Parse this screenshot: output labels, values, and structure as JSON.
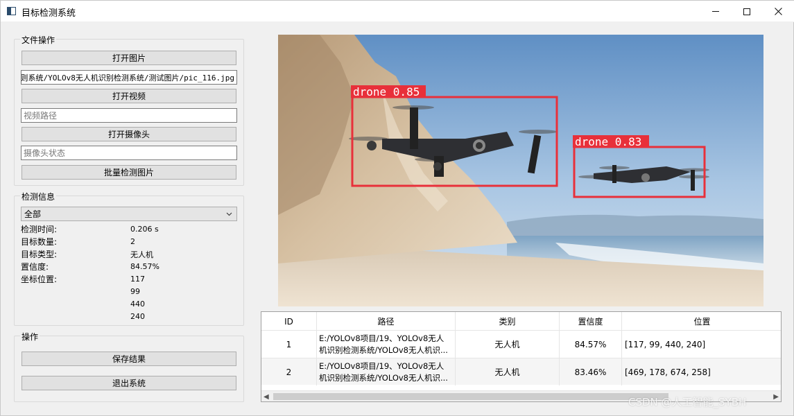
{
  "window": {
    "title": "目标检测系统"
  },
  "file_ops": {
    "group_title": "文件操作",
    "open_image_label": "打开图片",
    "image_path_value": "则系统/YOLOv8无人机识别检测系统/测试图片/pic_116.jpg",
    "open_video_label": "打开视频",
    "video_path_placeholder": "视频路径",
    "open_camera_label": "打开摄像头",
    "camera_status_placeholder": "摄像头状态",
    "batch_detect_label": "批量检测图片"
  },
  "detect_info": {
    "group_title": "检测信息",
    "filter_value": "全部",
    "time_label": "检测时间:",
    "time_value": "0.206 s",
    "count_label": "目标数量:",
    "count_value": "2",
    "type_label": "目标类型:",
    "type_value": "无人机",
    "conf_label": "置信度:",
    "conf_value": "84.57%",
    "coord_label": "坐标位置:",
    "coords": [
      "117",
      "99",
      "440",
      "240"
    ]
  },
  "ops": {
    "group_title": "操作",
    "save_label": "保存结果",
    "exit_label": "退出系统"
  },
  "detections_overlay": [
    {
      "label": "drone 0.85"
    },
    {
      "label": "drone 0.83"
    }
  ],
  "table": {
    "headers": [
      "ID",
      "路径",
      "类别",
      "置信度",
      "位置"
    ],
    "rows": [
      {
        "id": "1",
        "path_line1": "E:/YOLOv8项目/19、YOLOv8无人",
        "path_line2": "机识别检测系统/YOLOv8无人机识...",
        "class": "无人机",
        "conf": "84.57%",
        "position": "[117, 99, 440, 240]"
      },
      {
        "id": "2",
        "path_line1": "E:/YOLOv8项目/19、YOLOv8无人",
        "path_line2": "机识别检测系统/YOLOv8无人机识...",
        "class": "无人机",
        "conf": "83.46%",
        "position": "[469, 178, 674, 258]"
      }
    ]
  },
  "watermark": "CSDN @人工智能_SYBH",
  "colors": {
    "box": "#e8303a",
    "button_bg": "#e1e1e1",
    "window_bg": "#f0f0f0"
  },
  "icons": [
    "app-window-icon",
    "minimize-icon",
    "maximize-icon",
    "close-icon",
    "chevron-down-icon",
    "scroll-left-icon",
    "scroll-right-icon"
  ]
}
